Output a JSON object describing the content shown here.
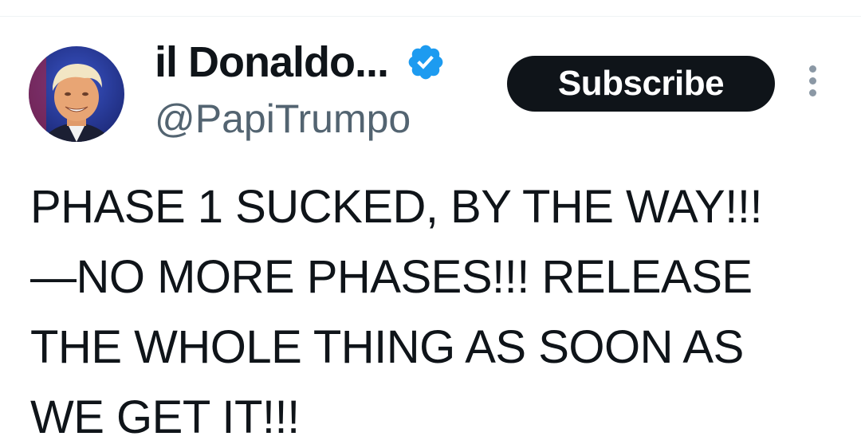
{
  "post": {
    "author": {
      "display_name": "il Donaldo...",
      "handle": "@PapiTrumpo",
      "verified_icon": "verified-badge-icon",
      "verified_color": "#1d9bf0"
    },
    "actions": {
      "subscribe_label": "Subscribe",
      "more_icon": "more-vertical-icon"
    },
    "text_lines": [
      "PHASE 1 SUCKED, BY THE WAY!!!",
      "—NO MORE PHASES!!! RELEASE",
      "THE WHOLE THING AS SOON AS",
      "WE GET IT!!!"
    ]
  },
  "colors": {
    "text": "#0f1419",
    "secondary_text": "#536471",
    "button_bg": "#0f1419",
    "button_text": "#ffffff"
  }
}
